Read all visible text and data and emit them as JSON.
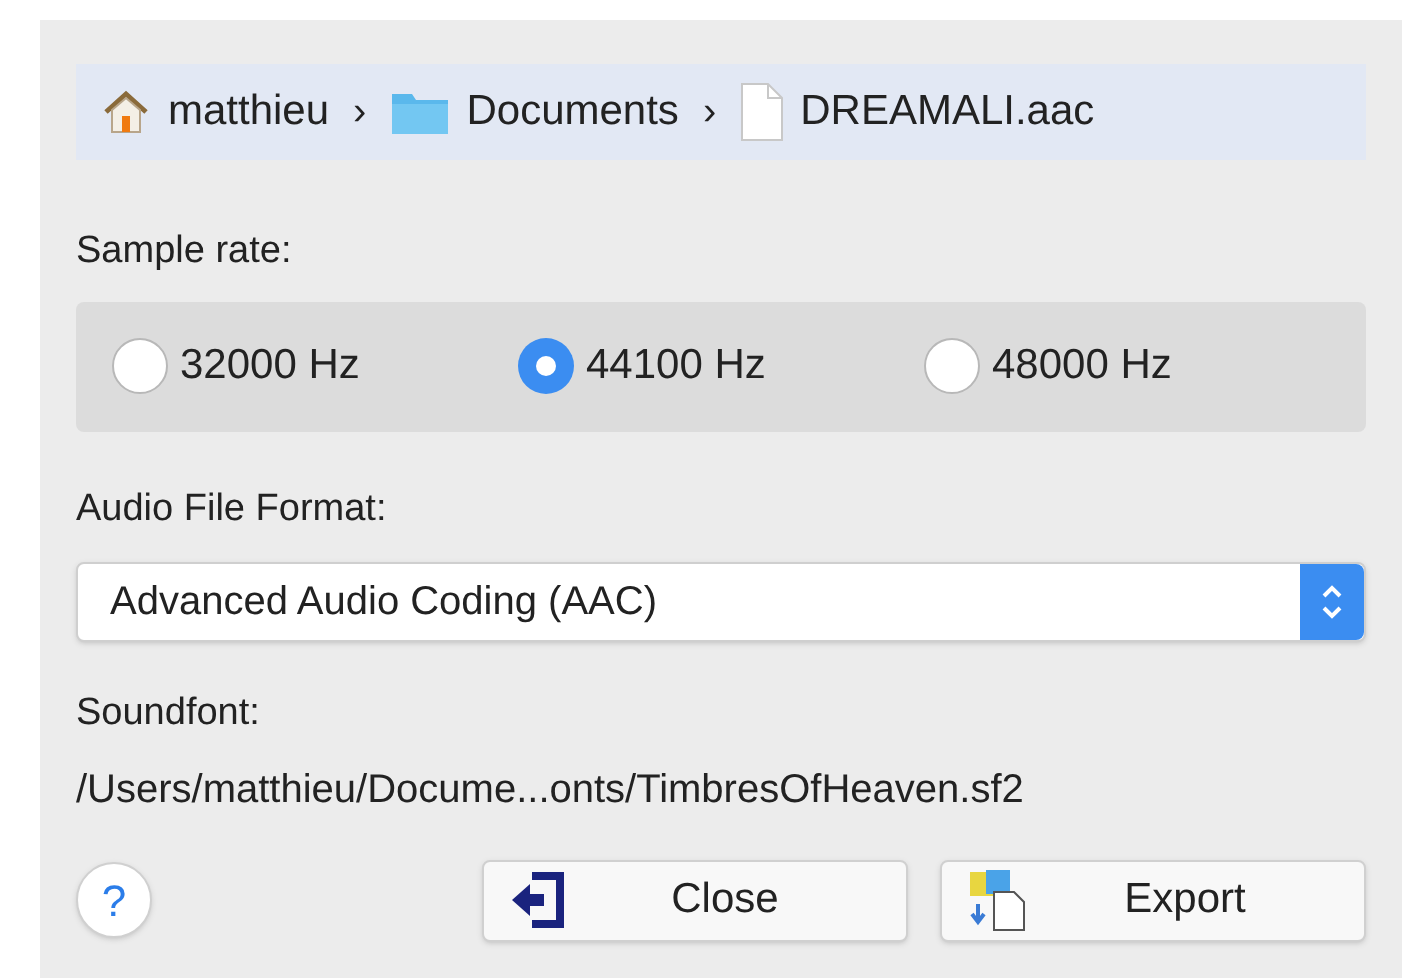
{
  "breadcrumb": [
    {
      "kind": "home",
      "label": "matthieu"
    },
    {
      "kind": "folder",
      "label": "Documents"
    },
    {
      "kind": "file",
      "label": "DREAMALI.aac"
    }
  ],
  "breadcrumb_separator": "›",
  "sample_rate": {
    "label": "Sample rate:",
    "options": [
      {
        "label": "32000 Hz",
        "selected": false
      },
      {
        "label": "44100 Hz",
        "selected": true
      },
      {
        "label": "48000 Hz",
        "selected": false
      }
    ]
  },
  "format": {
    "label": "Audio File Format:",
    "value": "Advanced Audio Coding (AAC)"
  },
  "soundfont": {
    "label": "Soundfont:",
    "path": "/Users/matthieu/Docume...onts/TimbresOfHeaven.sf2"
  },
  "help": "?",
  "buttons": [
    {
      "kind": "close",
      "label": "Close"
    },
    {
      "kind": "export",
      "label": "Export"
    }
  ]
}
